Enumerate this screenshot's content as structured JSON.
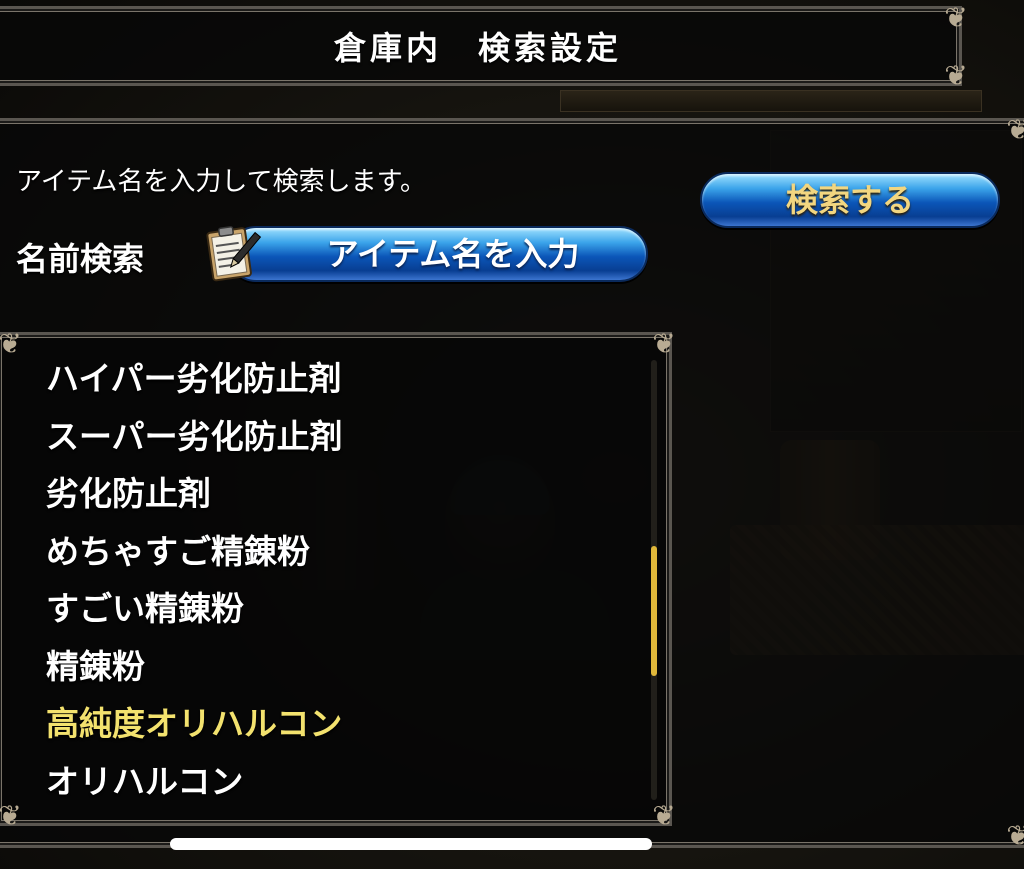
{
  "header": {
    "title": "倉庫内　検索設定"
  },
  "search": {
    "instructions": "アイテム名を入力して検索します。",
    "name_search_label": "名前検索",
    "input_label": "アイテム名を入力",
    "button_label": "検索する"
  },
  "items": [
    {
      "name": "ハイパー劣化防止剤",
      "highlighted": false
    },
    {
      "name": "スーパー劣化防止剤",
      "highlighted": false
    },
    {
      "name": "劣化防止剤",
      "highlighted": false
    },
    {
      "name": "めちゃすご精錬粉",
      "highlighted": false
    },
    {
      "name": "すごい精錬粉",
      "highlighted": false
    },
    {
      "name": "精錬粉",
      "highlighted": false
    },
    {
      "name": "高純度オリハルコン",
      "highlighted": true
    },
    {
      "name": "オリハルコン",
      "highlighted": false
    }
  ],
  "colors": {
    "highlight": "#f3e26e",
    "search_button_text": "#f2d680",
    "button_blue": "#0b56b8",
    "scroll_thumb": "#e0b83a"
  },
  "icons": {
    "input": "clipboard-pencil-icon",
    "corners": "ornament-corner-icon"
  }
}
